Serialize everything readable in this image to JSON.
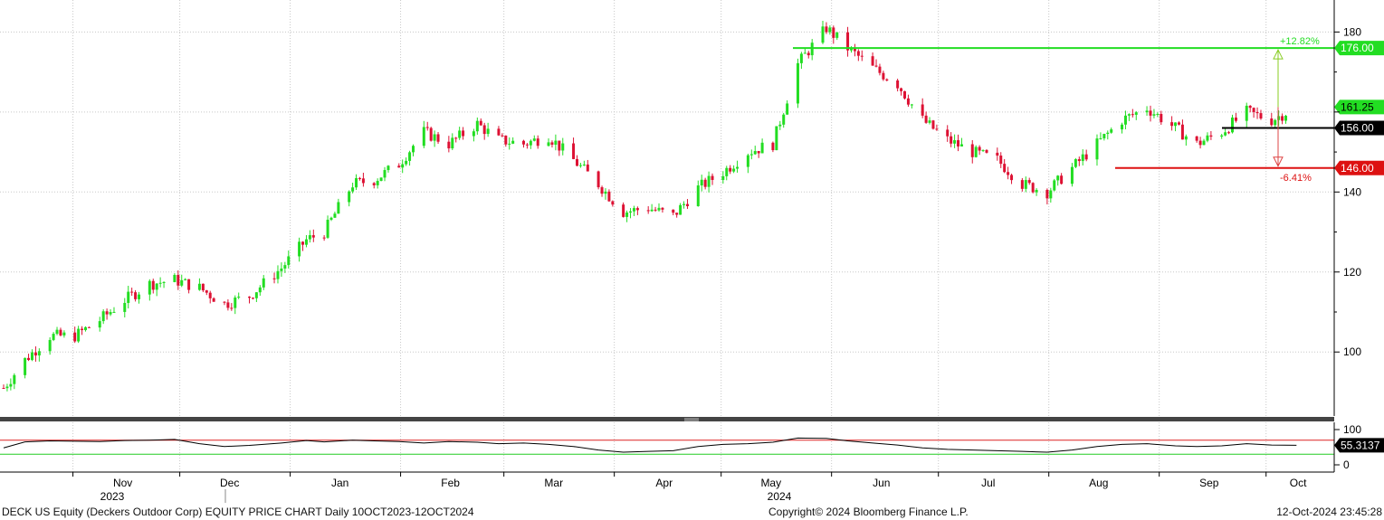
{
  "chart_data": [
    {
      "type": "candlestick",
      "title": "DECK US Equity (Deckers Outdoor Corp) EQUITY PRICE CHART",
      "ylim": [
        84,
        188
      ],
      "yticks": [
        100,
        120,
        140,
        180
      ],
      "grid": true,
      "x_axis": {
        "month_labels": [
          "Nov",
          "Dec",
          "Jan",
          "Feb",
          "Mar",
          "Apr",
          "May",
          "Jun",
          "Jul",
          "Aug",
          "Sep",
          "Oct"
        ],
        "year_labels": [
          "2023",
          "2024"
        ]
      },
      "x": [
        "2023-10-10",
        "2023-10-16",
        "2023-10-23",
        "2023-10-30",
        "2023-11-06",
        "2023-11-13",
        "2023-11-20",
        "2023-11-27",
        "2023-12-04",
        "2023-12-11",
        "2023-12-18",
        "2023-12-27",
        "2024-01-03",
        "2024-01-08",
        "2024-01-16",
        "2024-01-22",
        "2024-01-29",
        "2024-02-05",
        "2024-02-12",
        "2024-02-20",
        "2024-02-26",
        "2024-03-04",
        "2024-03-11",
        "2024-03-18",
        "2024-03-25",
        "2024-04-01",
        "2024-04-08",
        "2024-04-15",
        "2024-04-22",
        "2024-04-29",
        "2024-05-06",
        "2024-05-13",
        "2024-05-20",
        "2024-05-28",
        "2024-06-03",
        "2024-06-10",
        "2024-06-17",
        "2024-06-24",
        "2024-07-01",
        "2024-07-08",
        "2024-07-15",
        "2024-07-22",
        "2024-07-29",
        "2024-08-05",
        "2024-08-12",
        "2024-08-19",
        "2024-08-26",
        "2024-09-03",
        "2024-09-09",
        "2024-09-16",
        "2024-09-23",
        "2024-09-30",
        "2024-10-07"
      ],
      "close": [
        91,
        98,
        104,
        104,
        108,
        113,
        117,
        118,
        116,
        112,
        114,
        121,
        128,
        130,
        142,
        143,
        147,
        155,
        152,
        157,
        153,
        152,
        154,
        148,
        142,
        135,
        136,
        134,
        141,
        145,
        150,
        152,
        172,
        181,
        176,
        171,
        167,
        158,
        153,
        150,
        148,
        142,
        140,
        146,
        152,
        158,
        161,
        156,
        152,
        155,
        160,
        158,
        161.25
      ],
      "levels": [
        {
          "value": 176.0,
          "label": "176.00",
          "pct_label": "+12.82%",
          "color": "#22dd22"
        },
        {
          "value": 156.0,
          "label": "156.00",
          "color": "#000000"
        },
        {
          "value": 146.0,
          "label": "146.00",
          "pct_label": "-6.41%",
          "color": "#dd1111"
        }
      ],
      "last_price": {
        "value": 161.25,
        "label": "161.25"
      },
      "colors": {
        "up": "#22dd22",
        "down": "#dd1133",
        "grid": "#c8c8c8"
      }
    },
    {
      "type": "line",
      "ylim": [
        0,
        100
      ],
      "yticks": [
        0,
        100
      ],
      "upper_band": 70,
      "lower_band": 30,
      "last_value": {
        "value": 55.3137,
        "label": "55.3137"
      },
      "values": [
        48,
        65,
        68,
        67,
        66,
        69,
        70,
        72,
        60,
        52,
        55,
        62,
        69,
        65,
        70,
        68,
        66,
        62,
        66,
        64,
        60,
        62,
        58,
        52,
        42,
        36,
        38,
        40,
        52,
        58,
        60,
        64,
        76,
        75,
        68,
        62,
        56,
        48,
        44,
        42,
        40,
        38,
        36,
        42,
        52,
        58,
        60,
        54,
        52,
        54,
        60,
        56,
        55.3137
      ],
      "colors": {
        "line": "#000000",
        "upper_band": "#dd2222",
        "lower_band": "#22cc22"
      }
    }
  ],
  "footer": {
    "description": "DECK US Equity (Deckers Outdoor Corp) EQUITY PRICE CHART  Daily 10OCT2023-12OCT2024",
    "copyright": "Copyright© 2024 Bloomberg Finance L.P.",
    "timestamp": "12-Oct-2024 23:45:28"
  }
}
